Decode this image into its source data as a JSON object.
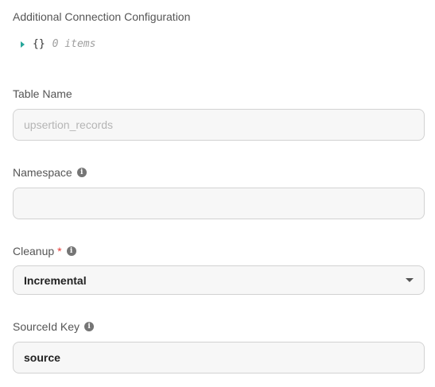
{
  "additional_config": {
    "label": "Additional Connection Configuration",
    "braces": "{}",
    "items_text": "0 items"
  },
  "table_name": {
    "label": "Table Name",
    "value": "",
    "placeholder": "upsertion_records"
  },
  "namespace": {
    "label": "Namespace",
    "value": "",
    "placeholder": ""
  },
  "cleanup": {
    "label": "Cleanup",
    "required_mark": "*",
    "selected": "Incremental"
  },
  "source_id_key": {
    "label": "SourceId Key",
    "value": "source"
  },
  "info_glyph": "i"
}
